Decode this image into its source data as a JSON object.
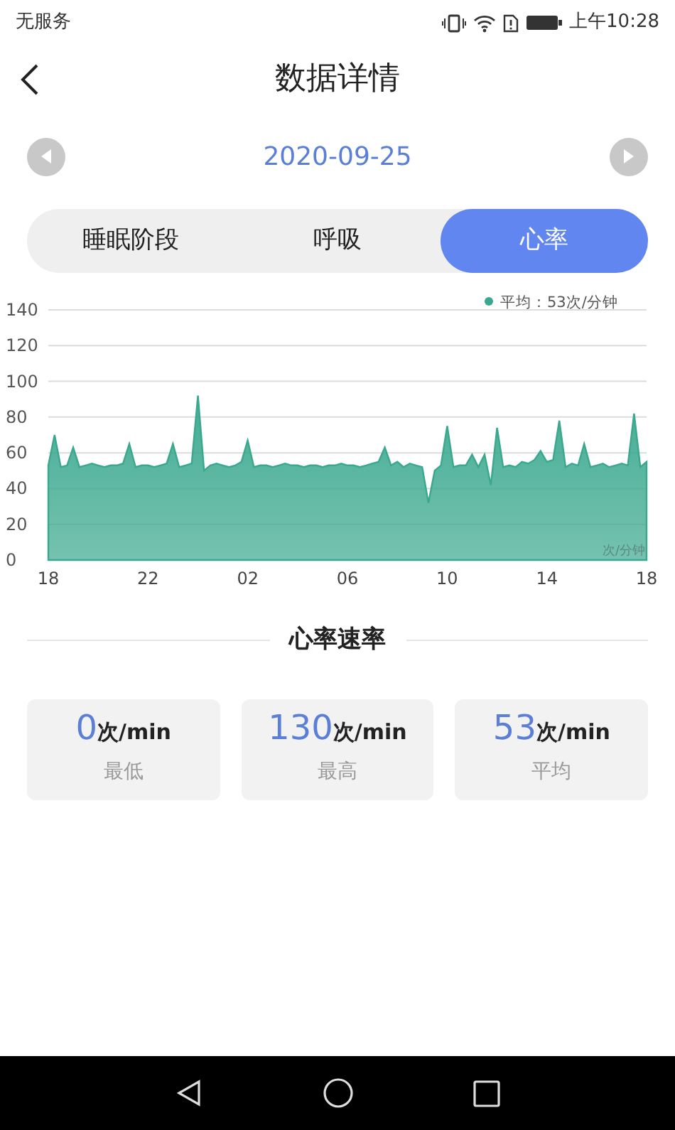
{
  "status_bar": {
    "carrier": "无服务",
    "time": "上午10:28"
  },
  "header": {
    "title": "数据详情"
  },
  "date_nav": {
    "date": "2020-09-25"
  },
  "tabs": [
    {
      "label": "睡眠阶段",
      "selected": false
    },
    {
      "label": "呼吸",
      "selected": false
    },
    {
      "label": "心率",
      "selected": true
    }
  ],
  "chart": {
    "chart_data": {
      "type": "area",
      "grid": true,
      "ylabel": "次/分钟",
      "ylim": [
        0,
        140
      ],
      "yticks": [
        0,
        20,
        40,
        60,
        80,
        100,
        120,
        140
      ],
      "categories": [
        "18",
        null,
        null,
        null,
        null,
        null,
        null,
        null,
        null,
        null,
        null,
        null,
        null,
        null,
        null,
        null,
        "22",
        null,
        null,
        null,
        null,
        null,
        null,
        null,
        null,
        null,
        null,
        null,
        null,
        null,
        null,
        null,
        "02",
        null,
        null,
        null,
        null,
        null,
        null,
        null,
        null,
        null,
        null,
        null,
        null,
        null,
        null,
        null,
        "06",
        null,
        null,
        null,
        null,
        null,
        null,
        null,
        null,
        null,
        null,
        null,
        null,
        null,
        null,
        null,
        "10",
        null,
        null,
        null,
        null,
        null,
        null,
        null,
        null,
        null,
        null,
        null,
        null,
        null,
        null,
        null,
        "14",
        null,
        null,
        null,
        null,
        null,
        null,
        null,
        null,
        null,
        null,
        null,
        null,
        null,
        null,
        null,
        "18"
      ],
      "series": [
        {
          "name": "平均：53次/分钟",
          "color": "#3aa88e",
          "values": [
            53,
            70,
            52,
            53,
            63,
            52,
            53,
            54,
            53,
            52,
            53,
            53,
            54,
            65,
            52,
            53,
            53,
            52,
            53,
            54,
            65,
            52,
            53,
            54,
            92,
            50,
            53,
            54,
            53,
            52,
            53,
            55,
            67,
            52,
            53,
            53,
            52,
            53,
            54,
            53,
            53,
            52,
            53,
            53,
            52,
            53,
            53,
            54,
            53,
            53,
            52,
            53,
            54,
            55,
            63,
            53,
            55,
            52,
            54,
            53,
            52,
            32,
            50,
            53,
            75,
            52,
            53,
            53,
            59,
            52,
            59,
            42,
            74,
            52,
            53,
            52,
            55,
            54,
            56,
            61,
            55,
            56,
            78,
            52,
            54,
            53,
            65,
            52,
            53,
            54,
            52,
            53,
            54,
            53,
            82,
            52,
            55
          ]
        }
      ]
    }
  },
  "section": {
    "title": "心率速率"
  },
  "stats": [
    {
      "value": "0",
      "unit": "次/min",
      "label": "最低"
    },
    {
      "value": "130",
      "unit": "次/min",
      "label": "最高"
    },
    {
      "value": "53",
      "unit": "次/min",
      "label": "平均"
    }
  ]
}
